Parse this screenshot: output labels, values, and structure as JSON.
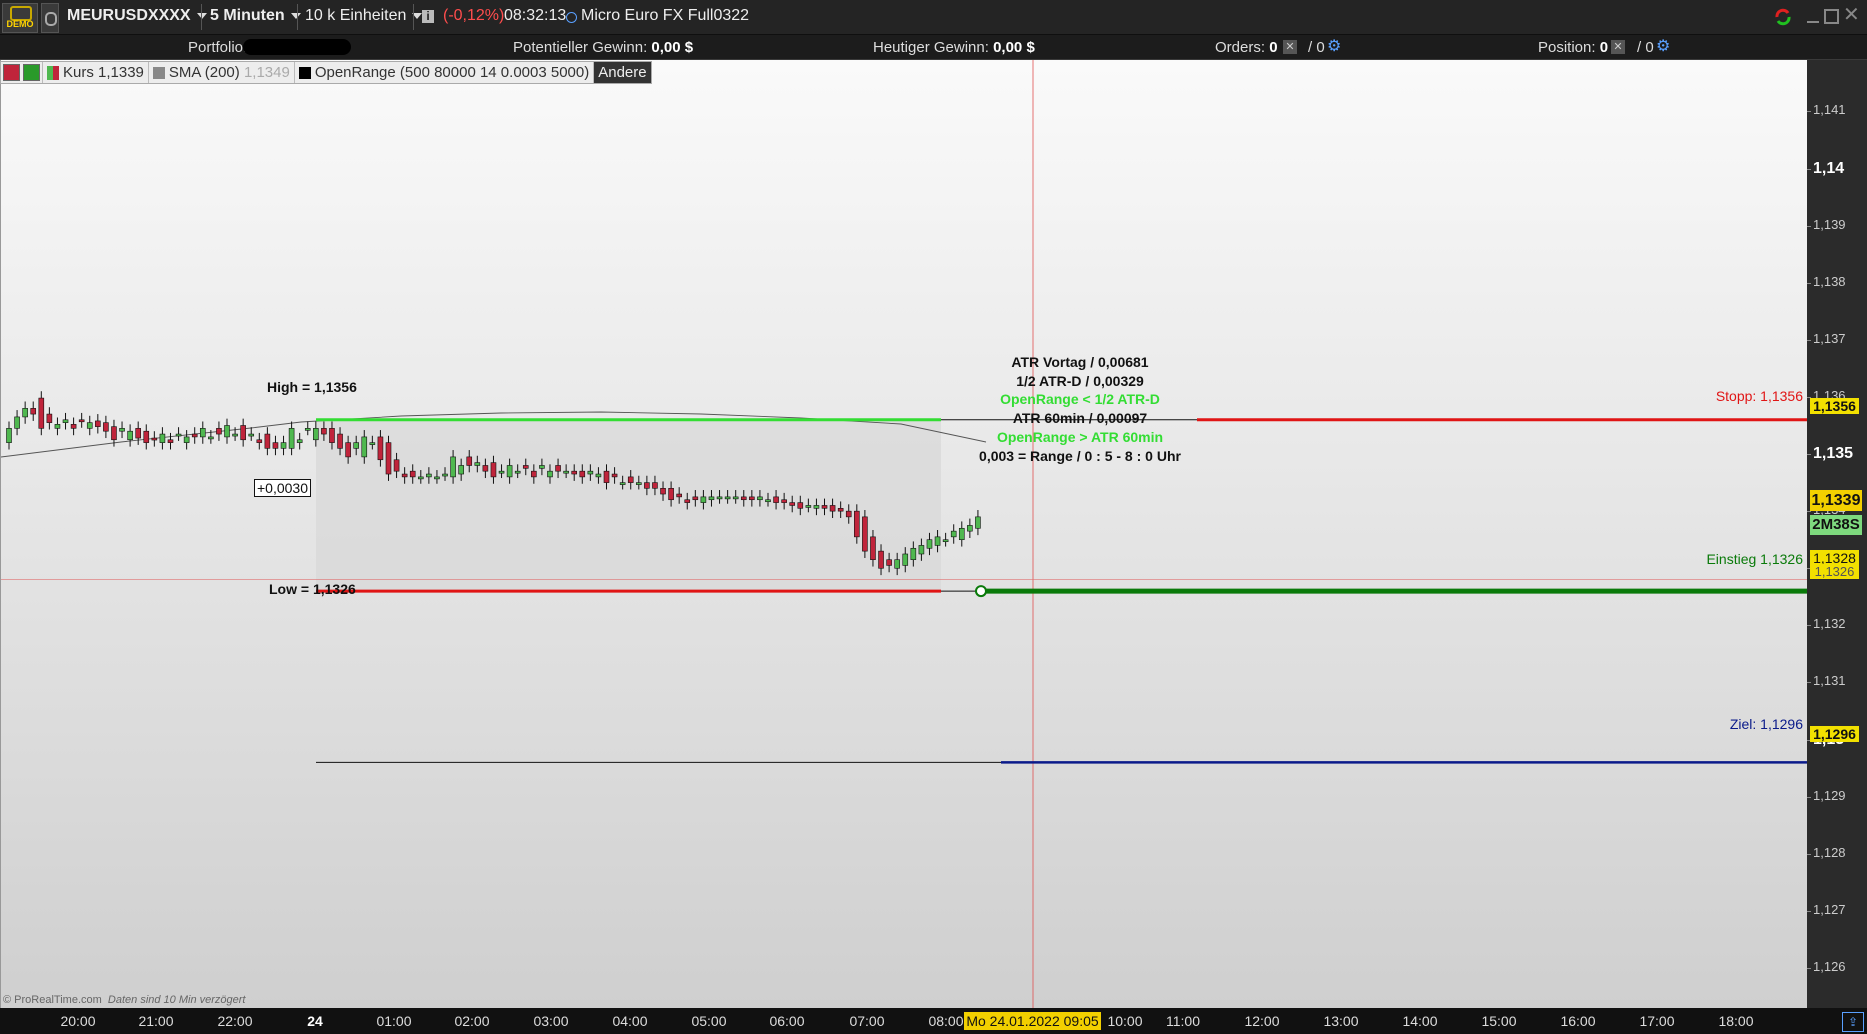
{
  "toolbar": {
    "demo_badge": "DEMO",
    "symbol": "MEURUSDXXXX",
    "timeframe": "5 Minuten",
    "units": "10 k Einheiten",
    "info_icon": "info-icon",
    "change": "(-0,12%)",
    "time": "08:32:13",
    "instrument": "Micro Euro FX Full0322"
  },
  "infobar": {
    "portfolio_label": "Portfolio:",
    "pot_gain_label": "Potentieller Gewinn:",
    "pot_gain_value": "0,00 $",
    "today_gain_label": "Heutiger Gewinn:",
    "today_gain_value": "0,00 $",
    "orders_label": "Orders:",
    "orders_a": "0",
    "orders_b": "/ 0",
    "position_label": "Position:",
    "position_a": "0",
    "position_b": "/ 0"
  },
  "legend": {
    "price": "Kurs 1,1339",
    "sma": "SMA (200)",
    "sma_value": "1,1349",
    "openrange": "OpenRange (500 80000 14 0.0003 5000)",
    "other": "Andere"
  },
  "annotations": {
    "high": "High = 1,1356",
    "low": "Low = 1,1326",
    "range_box": "+0,0030",
    "atr_vortag": "ATR Vortag / 0,00681",
    "half_atr": "1/2 ATR-D / 0,00329",
    "or_lt": "OpenRange < 1/2 ATR-D",
    "atr60": "ATR 60min / 0,00097",
    "or_gt": "OpenRange > ATR 60min",
    "range_time": "0,003  = Range / 0 : 5 - 8 : 0  Uhr",
    "stopp": "Stopp: 1,1356",
    "einstieg": "Einstieg 1,1326",
    "ziel": "Ziel: 1,1296",
    "footer": "© ProRealTime.com",
    "footer_note": "Daten sind 10 Min verzögert"
  },
  "yaxis": {
    "ticks": [
      "1,141",
      "1,14",
      "1,139",
      "1,138",
      "1,137",
      "1,136",
      "1,135",
      "1,134",
      "1,133",
      "1,132",
      "1,131",
      "1,13",
      "1,129",
      "1,128",
      "1,127",
      "1,126"
    ],
    "badges": {
      "stop": "1,1356",
      "last": "1,1339",
      "countdown": "2M38S",
      "cross": "1,1328",
      "entry": "1,1326",
      "target": "1,1296"
    }
  },
  "xaxis": {
    "labels": [
      "20:00",
      "21:00",
      "22:00",
      "24",
      "01:00",
      "02:00",
      "03:00",
      "04:00",
      "05:00",
      "06:00",
      "07:00",
      "08:00",
      "10:00",
      "11:00",
      "12:00",
      "13:00",
      "14:00",
      "15:00",
      "16:00",
      "17:00",
      "18:00"
    ],
    "cursor_date": "Mo 24.01.2022 09:05"
  },
  "colors": {
    "up": "#4fb84f",
    "down": "#c0243b",
    "stop": "#e01515",
    "entry": "#0a7a0a",
    "target": "#0a1a8a",
    "or_green": "#33dd33",
    "badge": "#f2e000"
  },
  "chart_data": {
    "type": "candlestick",
    "series": [
      {
        "open": [
          1.1352,
          1.13545,
          1.13565,
          1.1358,
          1.13598,
          1.1357,
          1.13545,
          1.13555,
          1.13552,
          1.1356,
          1.13545,
          1.13558,
          1.13555,
          1.13548,
          1.1354,
          1.13525,
          1.13545,
          1.1354,
          1.13528,
          1.1352,
          1.13525,
          1.13535,
          1.1352,
          1.13535,
          1.1353,
          1.1353,
          1.13545,
          1.1353,
          1.13535,
          1.1355,
          1.13535,
          1.13525,
          1.13535,
          1.1352,
          1.1351,
          1.1351,
          1.1352,
          1.13545,
          1.13525,
          1.13545,
          1.13545,
          1.13535,
          1.1352,
          1.1351,
          1.13495,
          1.1352,
          1.1353,
          1.1352,
          1.1349,
          1.13465,
          1.1347,
          1.1346,
          1.1346,
          1.1346,
          1.13465,
          1.1346,
          1.13465,
          1.13495,
          1.1348,
          1.1348,
          1.13485,
          1.1347,
          1.1346,
          1.1347,
          1.1348,
          1.1347,
          1.13475,
          1.1346,
          1.1348,
          1.1347,
          1.1347,
          1.1347,
          1.13465,
          1.1346,
          1.1347,
          1.13465,
          1.1345,
          1.1346,
          1.1345,
          1.1345,
          1.1345,
          1.1344,
          1.1344,
          1.1343,
          1.1342,
          1.13425,
          1.13415,
          1.1342,
          1.13425,
          1.13425,
          1.13425,
          1.13425,
          1.13425,
          1.1342,
          1.1342,
          1.13425,
          1.1342,
          1.13415,
          1.13415,
          1.1341,
          1.13405,
          1.1341,
          1.1341,
          1.13405,
          1.134,
          1.134,
          1.1339,
          1.13355,
          1.1333,
          1.13315,
          1.133,
          1.13305,
          1.13315,
          1.13325,
          1.13335,
          1.1334,
          1.1335,
          1.13355,
          1.1335,
          1.13365,
          1.1337,
          1.13375
        ],
        "close": [
          1.13545,
          1.13565,
          1.1358,
          1.1357,
          1.13545,
          1.13555,
          1.13552,
          1.1356,
          1.13545,
          1.13558,
          1.13555,
          1.13548,
          1.1354,
          1.13525,
          1.13545,
          1.1354,
          1.13528,
          1.1352,
          1.13525,
          1.13535,
          1.1352,
          1.13535,
          1.1353,
          1.1353,
          1.13545,
          1.1353,
          1.13535,
          1.1355,
          1.13535,
          1.13525,
          1.13535,
          1.1352,
          1.1351,
          1.1351,
          1.1352,
          1.13545,
          1.13525,
          1.13545,
          1.13545,
          1.13535,
          1.1352,
          1.1351,
          1.13495,
          1.1352,
          1.1353,
          1.1352,
          1.1349,
          1.13465,
          1.1347,
          1.1346,
          1.1346,
          1.1346,
          1.13465,
          1.1346,
          1.13465,
          1.13495,
          1.1348,
          1.1348,
          1.13485,
          1.1347,
          1.1346,
          1.1347,
          1.1348,
          1.1347,
          1.13475,
          1.1346,
          1.1348,
          1.1347,
          1.1347,
          1.1347,
          1.13465,
          1.1346,
          1.1347,
          1.13465,
          1.1345,
          1.1346,
          1.1345,
          1.1345,
          1.1345,
          1.1344,
          1.1344,
          1.1343,
          1.1342,
          1.13425,
          1.13415,
          1.1342,
          1.13425,
          1.13425,
          1.13425,
          1.13425,
          1.13425,
          1.1342,
          1.1342,
          1.13425,
          1.1342,
          1.13415,
          1.13415,
          1.1341,
          1.13405,
          1.1341,
          1.1341,
          1.13405,
          1.134,
          1.134,
          1.1339,
          1.13355,
          1.1333,
          1.13315,
          1.133,
          1.13305,
          1.13315,
          1.13325,
          1.13335,
          1.1334,
          1.1335,
          1.13355,
          1.1335,
          1.13365,
          1.1337,
          1.13375,
          1.1339
        ]
      }
    ],
    "ylim": [
      1.1253,
      1.1419
    ]
  }
}
